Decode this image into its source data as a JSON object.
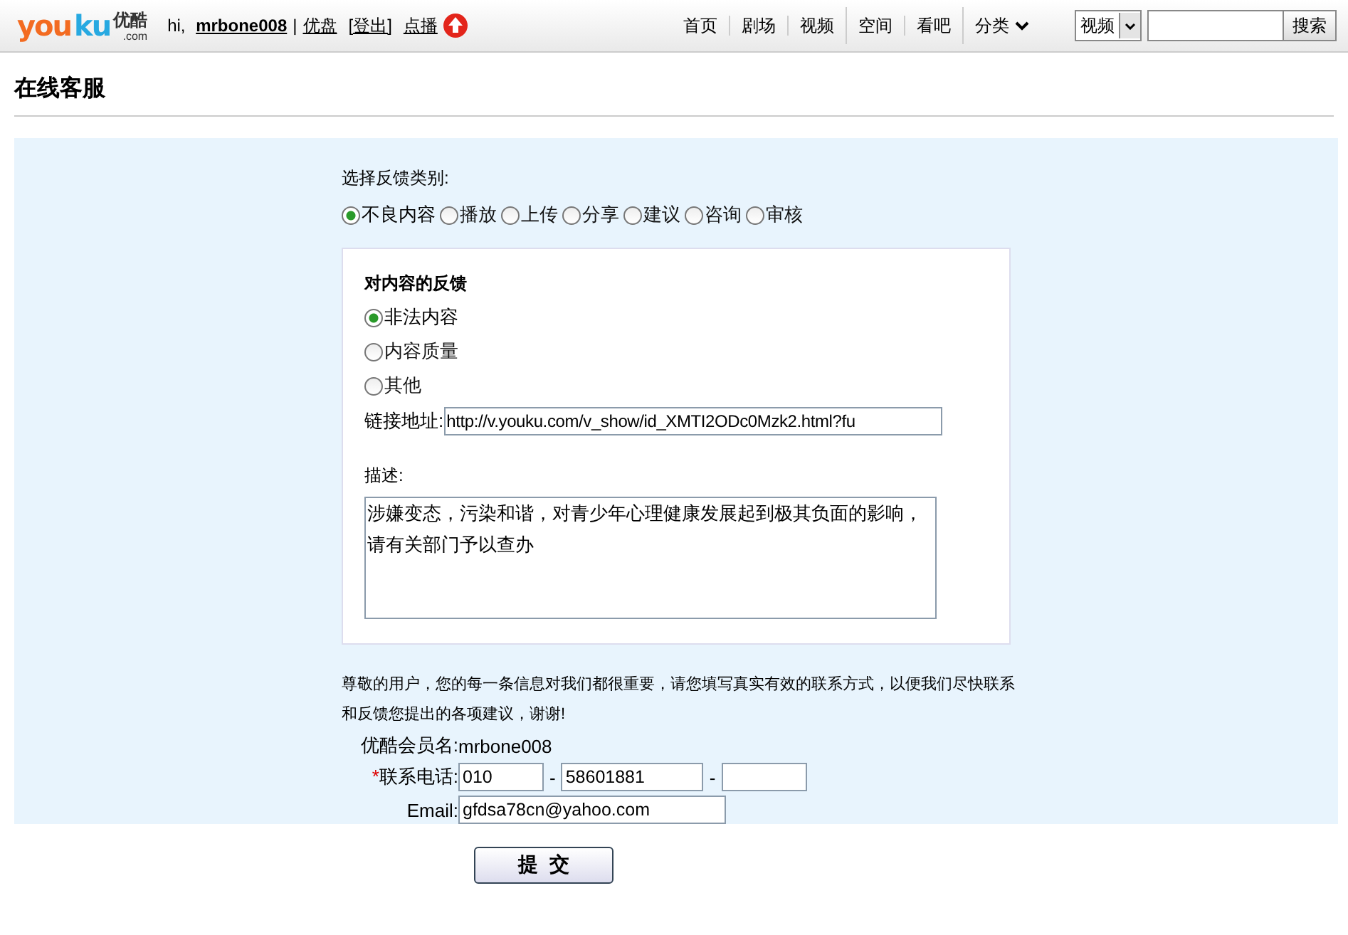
{
  "header": {
    "logo": {
      "latin": [
        "you",
        "ku"
      ],
      "chinese": "优酷",
      "domain": ".com"
    },
    "greeting": "hi,",
    "username": "mrbone008",
    "separator": "|",
    "links": [
      "优盘",
      "[登出]",
      "点播"
    ],
    "nav_groups": [
      [
        {
          "label": "首页"
        },
        {
          "label": "剧场"
        },
        {
          "label": "视频"
        }
      ],
      [
        {
          "label": "空间"
        },
        {
          "label": "看吧"
        }
      ],
      [
        {
          "label": "分类",
          "dropdown": true
        }
      ]
    ],
    "search": {
      "scope": "视频",
      "button": "搜索"
    }
  },
  "page_title": "在线客服",
  "category": {
    "label": "选择反馈类别:",
    "options": [
      {
        "label": "不良内容",
        "selected": true
      },
      {
        "label": "播放",
        "selected": false
      },
      {
        "label": "上传",
        "selected": false
      },
      {
        "label": "分享",
        "selected": false
      },
      {
        "label": "建议",
        "selected": false
      },
      {
        "label": "咨询",
        "selected": false
      },
      {
        "label": "审核",
        "selected": false
      }
    ]
  },
  "content_feedback": {
    "title": "对内容的反馈",
    "options": [
      {
        "label": "非法内容",
        "selected": true
      },
      {
        "label": "内容质量",
        "selected": false
      },
      {
        "label": "其他",
        "selected": false
      }
    ],
    "link_label": "链接地址:",
    "link_value": "http://v.youku.com/v_show/id_XMTI2ODc0Mzk2.html?fu",
    "description_label": "描述:",
    "description_value": "涉嫌变态，污染和谐，对青少年心理健康发展起到极其负面的影响，请有关部门予以查办"
  },
  "notice": "尊敬的用户，您的每一条信息对我们都很重要，请您填写真实有效的联系方式，以便我们尽快联系和反馈您提出的各项建议，谢谢!",
  "member": {
    "label": "优酷会员名:",
    "value": "mrbone008"
  },
  "phone": {
    "required_mark": "*",
    "label": "联系电话:",
    "parts": [
      "010",
      "58601881"
    ],
    "dash": "-"
  },
  "email": {
    "label": "Email:",
    "value": "gfdsa78cn@yahoo.com"
  },
  "submit": "提  交"
}
